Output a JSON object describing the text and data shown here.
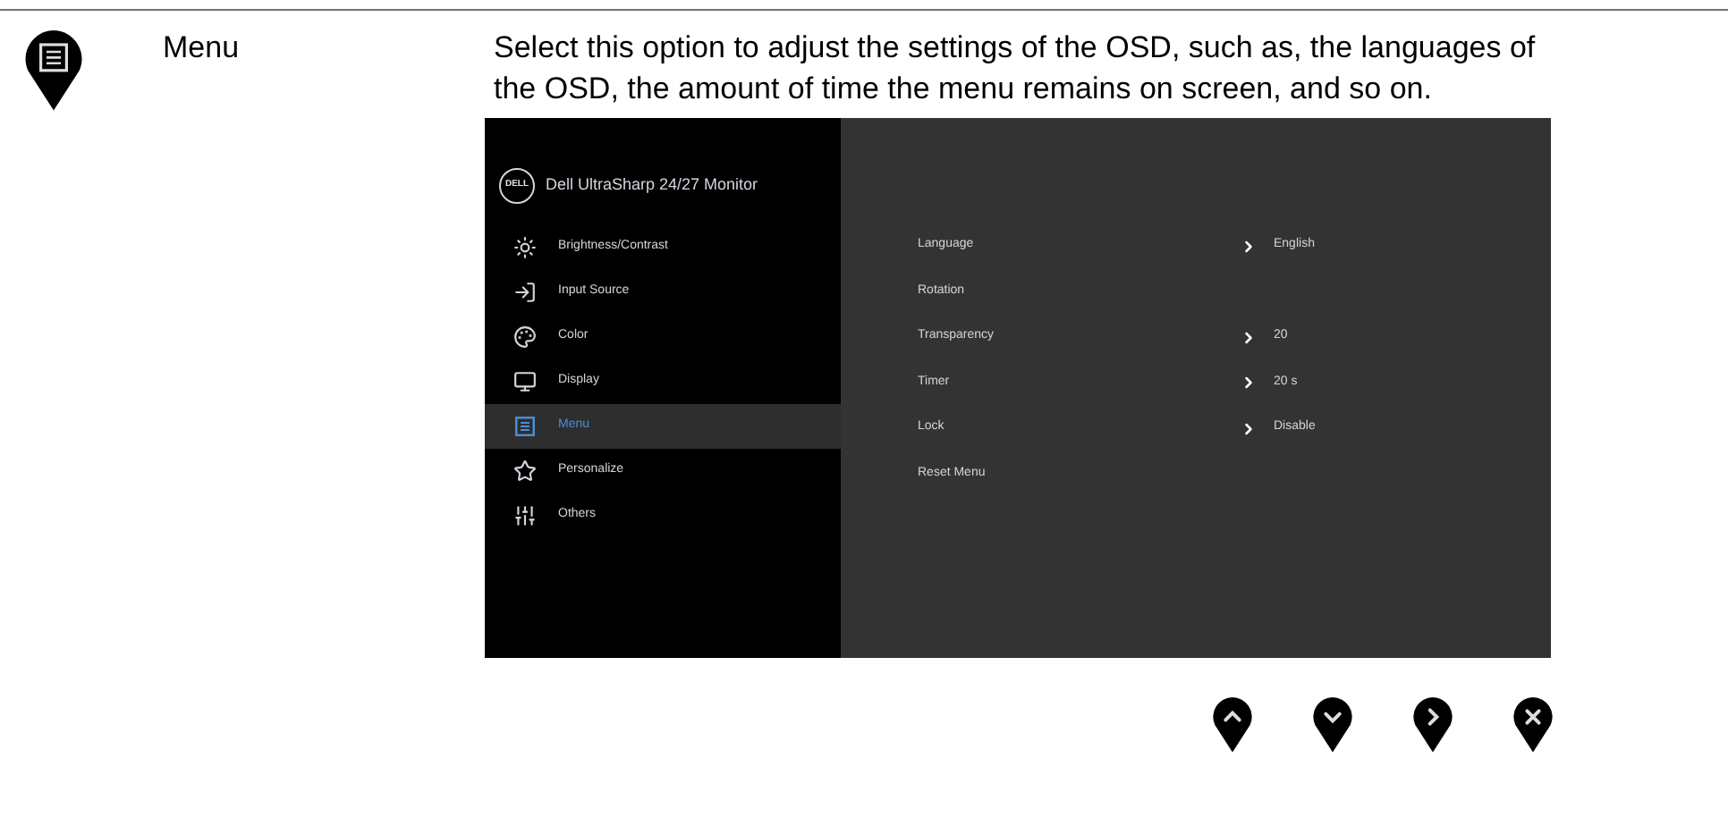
{
  "section": {
    "label": "Menu",
    "description": "Select this option to adjust the settings of the OSD, such as, the languages of the OSD, the amount of time the menu remains on screen, and so on."
  },
  "osd": {
    "title": "Dell UltraSharp 24/27 Monitor",
    "logo": "DELL",
    "sidebar": [
      {
        "label": "Brightness/Contrast",
        "kind": "brightness",
        "selected": false
      },
      {
        "label": "Input Source",
        "kind": "input",
        "selected": false
      },
      {
        "label": "Color",
        "kind": "color",
        "selected": false
      },
      {
        "label": "Display",
        "kind": "display",
        "selected": false
      },
      {
        "label": "Menu",
        "kind": "menu",
        "selected": true
      },
      {
        "label": "Personalize",
        "kind": "personalize",
        "selected": false
      },
      {
        "label": "Others",
        "kind": "others",
        "selected": false
      }
    ],
    "settings": [
      {
        "label": "Language",
        "has_submenu": true,
        "value": "English"
      },
      {
        "label": "Rotation",
        "has_submenu": false
      },
      {
        "label": "Transparency",
        "has_submenu": true,
        "value": "20"
      },
      {
        "label": "Timer",
        "has_submenu": true,
        "value": "20 s"
      },
      {
        "label": "Lock",
        "has_submenu": true,
        "value": "Disable"
      },
      {
        "label": "Reset Menu",
        "has_submenu": false
      }
    ]
  },
  "buttons": [
    {
      "kind": "up"
    },
    {
      "kind": "down"
    },
    {
      "kind": "right"
    },
    {
      "kind": "close"
    }
  ]
}
